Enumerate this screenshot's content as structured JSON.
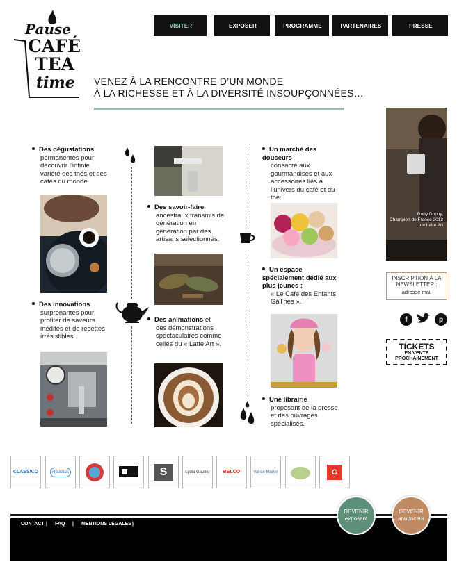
{
  "logo": {
    "line1": "Pause",
    "line2": "CAFÉ",
    "line3": "TEA",
    "line4": "time"
  },
  "nav": [
    "VISITER",
    "EXPOSER",
    "PROGRAMME",
    "PARTENAIRES",
    "PRESSE"
  ],
  "headline": {
    "line1": "VENEZ À LA RENCONTRE D’UN MONDE",
    "line2": "À LA RICHESSE ET À LA DIVERSITÉ INSOUPÇONNÉES…"
  },
  "col1": {
    "item1_bold": "Des dégustations",
    "item1_text": "permanentes pour découvrir l’infinie variété des thés et des cafés du monde.",
    "item2_bold": "Des innovations",
    "item2_text": "surprenantes pour profiter de saveurs inédites et de recettes irrésistibles."
  },
  "col2": {
    "item1_bold": "Des savoir-faire",
    "item1_text": "ancestraux transmis de génération en génération par des artisans sélectionnés.",
    "item2_bold": "Des animations",
    "item2_text_a": "et",
    "item2_text_b": "des démonstrations spectaculaires comme celles du « Latte Art »."
  },
  "col3": {
    "item1_bold": "Un marché des douceurs",
    "item1_text": "consacré aux gourmandises et aux accessoires liés à l’univers du café et du thé.",
    "item2_bold": "Un espace spécialement dédié aux plus jeunes :",
    "item2_text": "« Le Café des Enfants GâThés ».",
    "item3_bold": "Une librairie",
    "item3_text": "proposant de la presse et des ouvrages spécialisés."
  },
  "sidebar": {
    "rudy_name": "Rudy Dupuy,",
    "rudy_title": "Champion de France 2013 de Latte Art",
    "newsletter_title": "INSCRIPTION À LA NEWSLETTER :",
    "newsletter_placeholder": "adresse mail",
    "social": {
      "facebook": "f",
      "twitter": "t",
      "pinterest": "p"
    },
    "tickets_big": "TICKETS",
    "tickets_small1": "EN VENTE",
    "tickets_small2": "PROCHAINEMENT"
  },
  "partners": [
    "CLASSICO",
    "Roucous",
    "",
    "",
    "S",
    "Lydia Gautier",
    "BELCO",
    "Val de Marne",
    "",
    "G"
  ],
  "footer": {
    "contact": "CONTACT",
    "faq": "FAQ",
    "mentions": "MENTIONS LÉGALES",
    "sep": "|"
  },
  "cta": {
    "exposant_l1": "DEVENIR",
    "exposant_l2": "exposant",
    "annonceur_l1": "DEVENIR",
    "annonceur_l2": "annonceur"
  },
  "colors": {
    "accent_green": "#9fb9a9",
    "exposant_bg": "#5e8f78",
    "annonceur_bg": "#c08a64",
    "nav_active": "#9fd7bd"
  }
}
